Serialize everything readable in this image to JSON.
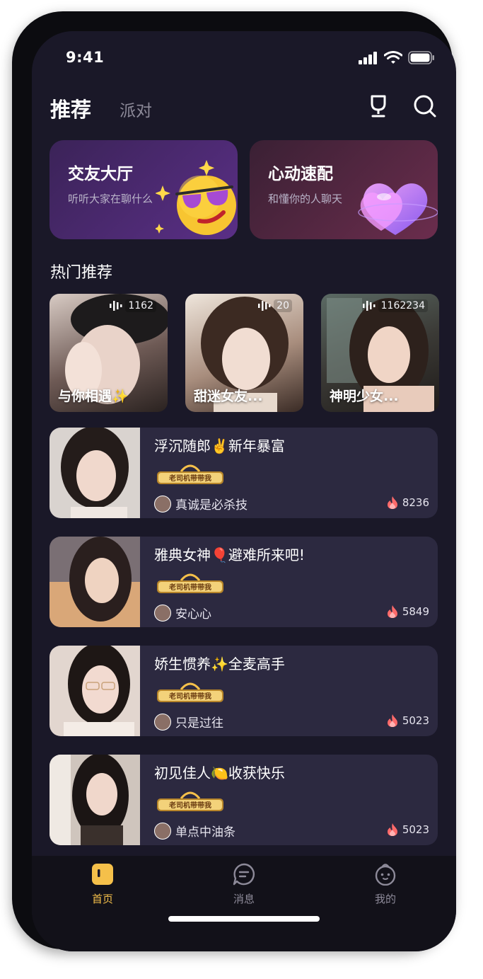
{
  "status_bar": {
    "time": "9:41"
  },
  "header": {
    "tabs": [
      {
        "label": "推荐",
        "active": true
      },
      {
        "label": "派对",
        "active": false
      }
    ],
    "icons": [
      "trophy-icon",
      "search-icon"
    ]
  },
  "features": [
    {
      "title": "交友大厅",
      "subtitle": "听听大家在聊什么",
      "icon": "sunglasses-emoji-icon"
    },
    {
      "title": "心动速配",
      "subtitle": "和懂你的人聊天",
      "icon": "heart-icon"
    }
  ],
  "hot_section": {
    "title": "热门推荐",
    "items": [
      {
        "name": "与你相遇✨",
        "listeners": "1162"
      },
      {
        "name": "甜迷女友...",
        "listeners": "20"
      },
      {
        "name": "神明少女...",
        "listeners": "1162234"
      }
    ]
  },
  "rooms": [
    {
      "title": "浮沉随郎✌️新年暴富",
      "badge": "老司机带带我",
      "owner": "真诚是必杀技",
      "heat": "8236"
    },
    {
      "title": "雅典女神🎈避难所来吧!",
      "badge": "老司机带带我",
      "owner": "安心心",
      "heat": "5849"
    },
    {
      "title": "娇生惯养✨全麦高手",
      "badge": "老司机带带我",
      "owner": "只是过往",
      "heat": "5023"
    },
    {
      "title": "初见佳人🍋收获快乐",
      "badge": "老司机带带我",
      "owner": "单点中油条",
      "heat": "5023"
    }
  ],
  "tabbar": [
    {
      "label": "首页",
      "active": true
    },
    {
      "label": "消息",
      "active": false
    },
    {
      "label": "我的",
      "active": false
    }
  ],
  "colors": {
    "background": "#1a1828",
    "card": "#2c2940",
    "accent": "#f5c04a",
    "muted": "#8d8a99"
  }
}
